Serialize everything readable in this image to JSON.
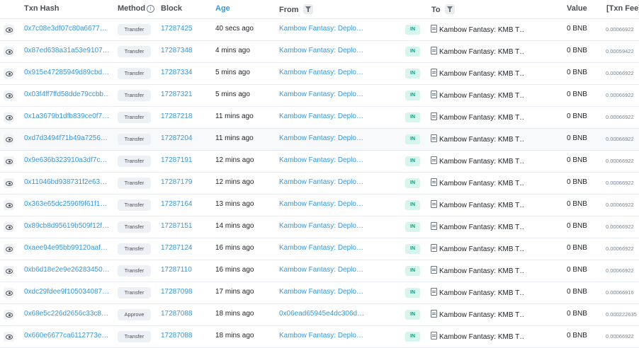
{
  "columns": {
    "txn_hash": "Txn Hash",
    "method": "Method",
    "block": "Block",
    "age": "Age",
    "from": "From",
    "to": "To",
    "value": "Value",
    "txn_fee": "[Txn Fee]"
  },
  "rows": [
    {
      "hash": "0x7c08e3df07c80a6677…",
      "method": "Transfer",
      "block": "17287425",
      "age": "40 secs ago",
      "from": "Kambow Fantasy: Deplo…",
      "direction": "IN",
      "to": "Kambow Fantasy: KMB T…",
      "value": "0 BNB",
      "fee": "0.00066922"
    },
    {
      "hash": "0x87ed638a31a53e9107…",
      "method": "Transfer",
      "block": "17287348",
      "age": "4 mins ago",
      "from": "Kambow Fantasy: Deplo…",
      "direction": "IN",
      "to": "Kambow Fantasy: KMB T…",
      "value": "0 BNB",
      "fee": "0.00059422"
    },
    {
      "hash": "0x915e47285949d89cbd…",
      "method": "Transfer",
      "block": "17287334",
      "age": "5 mins ago",
      "from": "Kambow Fantasy: Deplo…",
      "direction": "IN",
      "to": "Kambow Fantasy: KMB T…",
      "value": "0 BNB",
      "fee": "0.00066922"
    },
    {
      "hash": "0x03f4ff7ffd58dde79ccbb…",
      "method": "Transfer",
      "block": "17287321",
      "age": "5 mins ago",
      "from": "Kambow Fantasy: Deplo…",
      "direction": "IN",
      "to": "Kambow Fantasy: KMB T…",
      "value": "0 BNB",
      "fee": "0.00066922"
    },
    {
      "hash": "0x1a3679b1dfb839ce0f7…",
      "method": "Transfer",
      "block": "17287218",
      "age": "11 mins ago",
      "from": "Kambow Fantasy: Deplo…",
      "direction": "IN",
      "to": "Kambow Fantasy: KMB T…",
      "value": "0 BNB",
      "fee": "0.00066922"
    },
    {
      "hash": "0xd7d3494f71b49a7256…",
      "method": "Transfer",
      "block": "17287204",
      "age": "11 mins ago",
      "from": "Kambow Fantasy: Deplo…",
      "direction": "IN",
      "to": "Kambow Fantasy: KMB T…",
      "value": "0 BNB",
      "fee": "0.00066922"
    },
    {
      "hash": "0x9e636b323910a3df7c…",
      "method": "Transfer",
      "block": "17287191",
      "age": "12 mins ago",
      "from": "Kambow Fantasy: Deplo…",
      "direction": "IN",
      "to": "Kambow Fantasy: KMB T…",
      "value": "0 BNB",
      "fee": "0.00066922"
    },
    {
      "hash": "0x11046bd938731f2e63…",
      "method": "Transfer",
      "block": "17287179",
      "age": "12 mins ago",
      "from": "Kambow Fantasy: Deplo…",
      "direction": "IN",
      "to": "Kambow Fantasy: KMB T…",
      "value": "0 BNB",
      "fee": "0.00066922"
    },
    {
      "hash": "0x363e65dc2596f9f61f1…",
      "method": "Transfer",
      "block": "17287164",
      "age": "13 mins ago",
      "from": "Kambow Fantasy: Deplo…",
      "direction": "IN",
      "to": "Kambow Fantasy: KMB T…",
      "value": "0 BNB",
      "fee": "0.00066922"
    },
    {
      "hash": "0x89cb8d95619b509f12f…",
      "method": "Transfer",
      "block": "17287151",
      "age": "14 mins ago",
      "from": "Kambow Fantasy: Deplo…",
      "direction": "IN",
      "to": "Kambow Fantasy: KMB T…",
      "value": "0 BNB",
      "fee": "0.00066922"
    },
    {
      "hash": "0xaee94e95bb99120aaf…",
      "method": "Transfer",
      "block": "17287124",
      "age": "16 mins ago",
      "from": "Kambow Fantasy: Deplo…",
      "direction": "IN",
      "to": "Kambow Fantasy: KMB T…",
      "value": "0 BNB",
      "fee": "0.00066922"
    },
    {
      "hash": "0xb6d18e2e9e26283450…",
      "method": "Transfer",
      "block": "17287110",
      "age": "16 mins ago",
      "from": "Kambow Fantasy: Deplo…",
      "direction": "IN",
      "to": "Kambow Fantasy: KMB T…",
      "value": "0 BNB",
      "fee": "0.00066922"
    },
    {
      "hash": "0xdc29fdee9f105034087…",
      "method": "Transfer",
      "block": "17287098",
      "age": "17 mins ago",
      "from": "Kambow Fantasy: Deplo…",
      "direction": "IN",
      "to": "Kambow Fantasy: KMB T…",
      "value": "0 BNB",
      "fee": "0.00066916"
    },
    {
      "hash": "0x68e5c226d2656c33c8…",
      "method": "Approve",
      "block": "17287088",
      "age": "18 mins ago",
      "from": "0x06ead65945e4dc306d…",
      "direction": "IN",
      "to": "Kambow Fantasy: KMB T…",
      "value": "0 BNB",
      "fee": "0.000222635"
    },
    {
      "hash": "0x660e6677ca6112773e…",
      "method": "Transfer",
      "block": "17287088",
      "age": "18 mins ago",
      "from": "Kambow Fantasy: Deplo…",
      "direction": "IN",
      "to": "Kambow Fantasy: KMB T…",
      "value": "0 BNB",
      "fee": "0.00066922"
    }
  ],
  "icons": {
    "info": "info-circle-icon",
    "filter": "filter-icon",
    "eye": "eye-icon",
    "contract": "document-icon"
  },
  "colors": {
    "link": "#3498db",
    "in_badge_bg": "#d6f5ec",
    "in_badge_text": "#00a186",
    "method_bg": "#edf0f4",
    "row_border": "#e7eaf3",
    "row_highlight": "#f8f9fa"
  }
}
